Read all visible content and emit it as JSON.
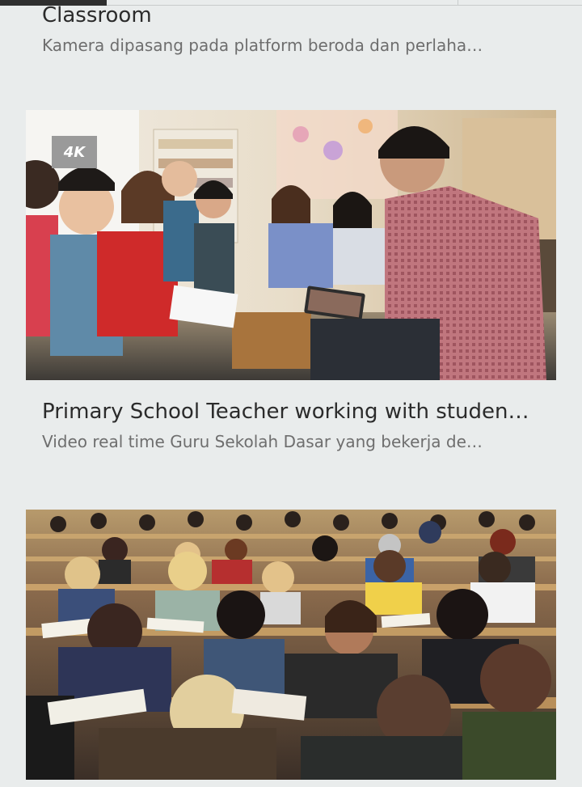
{
  "cards": [
    {
      "title": "Classroom",
      "description": "Kamera dipasang pada platform beroda dan perlaha…"
    },
    {
      "badge": "4K",
      "title": "Primary School Teacher working with studen…",
      "description": "Video real time Guru Sekolah Dasar yang bekerja de…"
    },
    {
      "title": "",
      "description": ""
    }
  ]
}
